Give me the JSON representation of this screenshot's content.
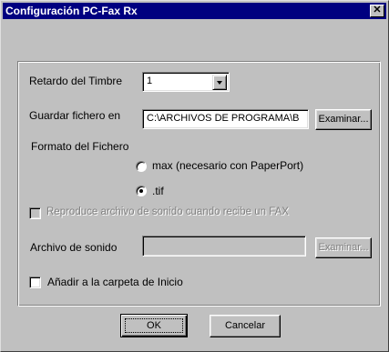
{
  "window": {
    "title": "Configuración PC-Fax Rx",
    "close_glyph": "✕"
  },
  "form": {
    "ring_delay": {
      "label": "Retardo del Timbre",
      "selected": "1"
    },
    "save_folder": {
      "label": "Guardar fichero en",
      "value": "C:\\ARCHIVOS DE PROGRAMA\\B",
      "browse_label": "Examinar..."
    },
    "file_format": {
      "label": "Formato del Fichero",
      "options": [
        {
          "label": "max (necesario con PaperPort)",
          "checked": false
        },
        {
          "label": ".tif",
          "checked": true
        }
      ]
    },
    "play_sound": {
      "label": "Reproduce archivo de sonido cuando recibe un FAX",
      "checked": false,
      "enabled": false
    },
    "sound_file": {
      "label": "Archivo de sonido",
      "value": "",
      "browse_label": "Examinar...",
      "enabled": false
    },
    "add_startup": {
      "label": "Añadir a la carpeta de Inicio",
      "checked": false
    }
  },
  "buttons": {
    "ok": "OK",
    "cancel": "Cancelar"
  }
}
